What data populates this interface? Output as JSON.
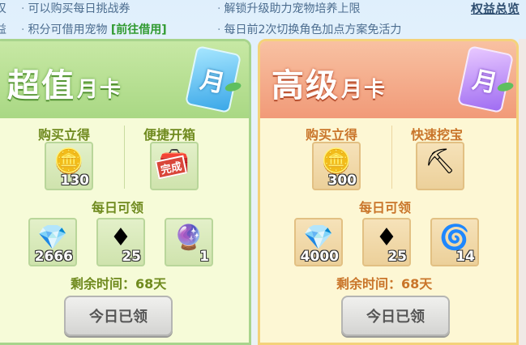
{
  "topbar": {
    "left_col": [
      "叹",
      "益"
    ],
    "row1_a": "可以购买每日挑战券",
    "row1_b": "解锁升级助力宠物培养上限",
    "row2_a": "积分可借用宠物",
    "row2_a_link": "[前往借用]",
    "row2_b": "每日前2次切换角色加点方案免活力",
    "rights_link": "权益总览"
  },
  "cards": [
    {
      "title": "超值",
      "title_suffix": "月卡",
      "badge": "月",
      "buy_label": "购买立得",
      "perk_label": "便捷开箱",
      "buy_item": {
        "icon": "gold-ingot-icon",
        "count": "130"
      },
      "perk_item": {
        "icon": "treasure-chest-icon",
        "stamp": "完成"
      },
      "daily_label": "每日可领",
      "daily_items": [
        {
          "icon": "silver-ingot-icon",
          "count": "2666"
        },
        {
          "icon": "red-gem-icon",
          "count": "25"
        },
        {
          "icon": "blue-orb-icon",
          "count": "1"
        }
      ],
      "remain": "剩余时间：68天",
      "claim": "今日已领"
    },
    {
      "title": "高级",
      "title_suffix": "月卡",
      "badge": "月",
      "buy_label": "购买立得",
      "perk_label": "快速挖宝",
      "buy_item": {
        "icon": "gold-ingot-icon",
        "count": "300"
      },
      "perk_item": {
        "icon": "shovel-icon"
      },
      "daily_label": "每日可领",
      "daily_items": [
        {
          "icon": "silver-ingot-icon",
          "count": "4000"
        },
        {
          "icon": "red-gem-icon",
          "count": "25"
        },
        {
          "icon": "blue-swirl-icon",
          "count": "14"
        }
      ],
      "remain": "剩余时间：68天",
      "claim": "今日已领"
    }
  ]
}
